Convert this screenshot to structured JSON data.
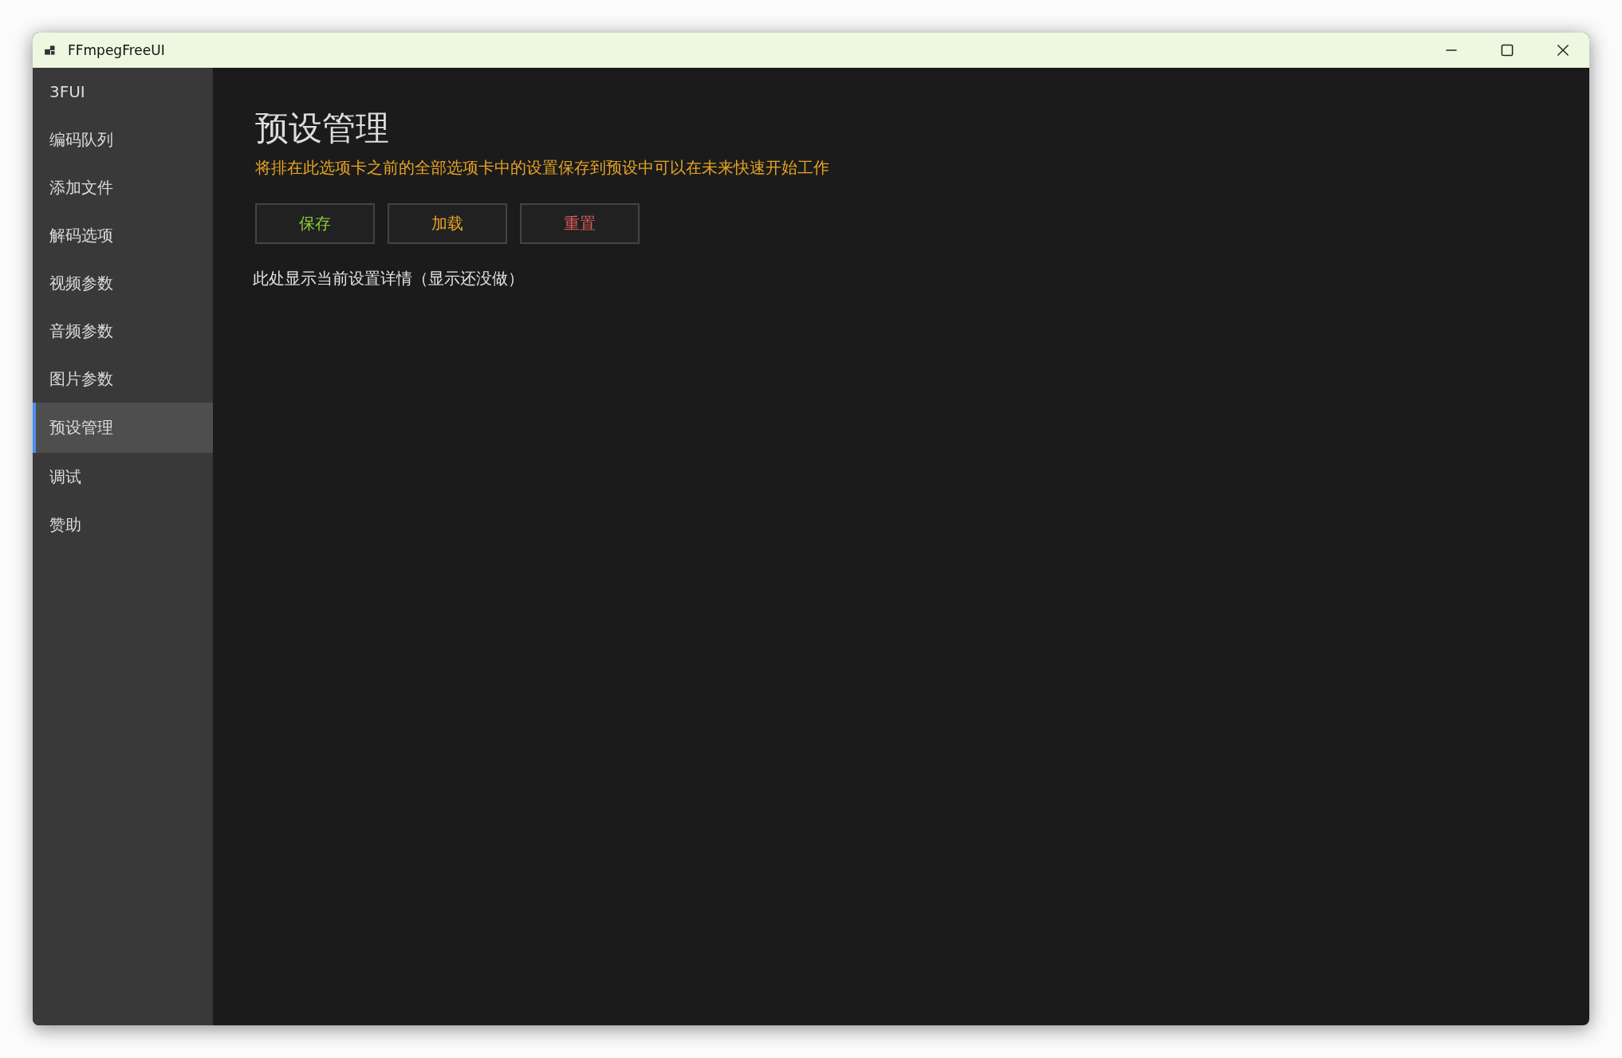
{
  "window": {
    "title": "FFmpegFreeUI"
  },
  "sidebar": {
    "items": [
      {
        "label": "3FUI",
        "selected": false
      },
      {
        "label": "编码队列",
        "selected": false
      },
      {
        "label": "添加文件",
        "selected": false
      },
      {
        "label": "解码选项",
        "selected": false
      },
      {
        "label": "视频参数",
        "selected": false
      },
      {
        "label": "音频参数",
        "selected": false
      },
      {
        "label": "图片参数",
        "selected": false
      },
      {
        "label": "预设管理",
        "selected": true
      },
      {
        "label": "调试",
        "selected": false
      },
      {
        "label": "赞助",
        "selected": false
      }
    ]
  },
  "page": {
    "title": "预设管理",
    "description": "将排在此选项卡之前的全部选项卡中的设置保存到预设中可以在未来快速开始工作",
    "buttons": [
      {
        "label": "保存",
        "kind": "save"
      },
      {
        "label": "加载",
        "kind": "load"
      },
      {
        "label": "重置",
        "kind": "reset"
      }
    ],
    "details": "此处显示当前设置详情（显示还没做）"
  }
}
